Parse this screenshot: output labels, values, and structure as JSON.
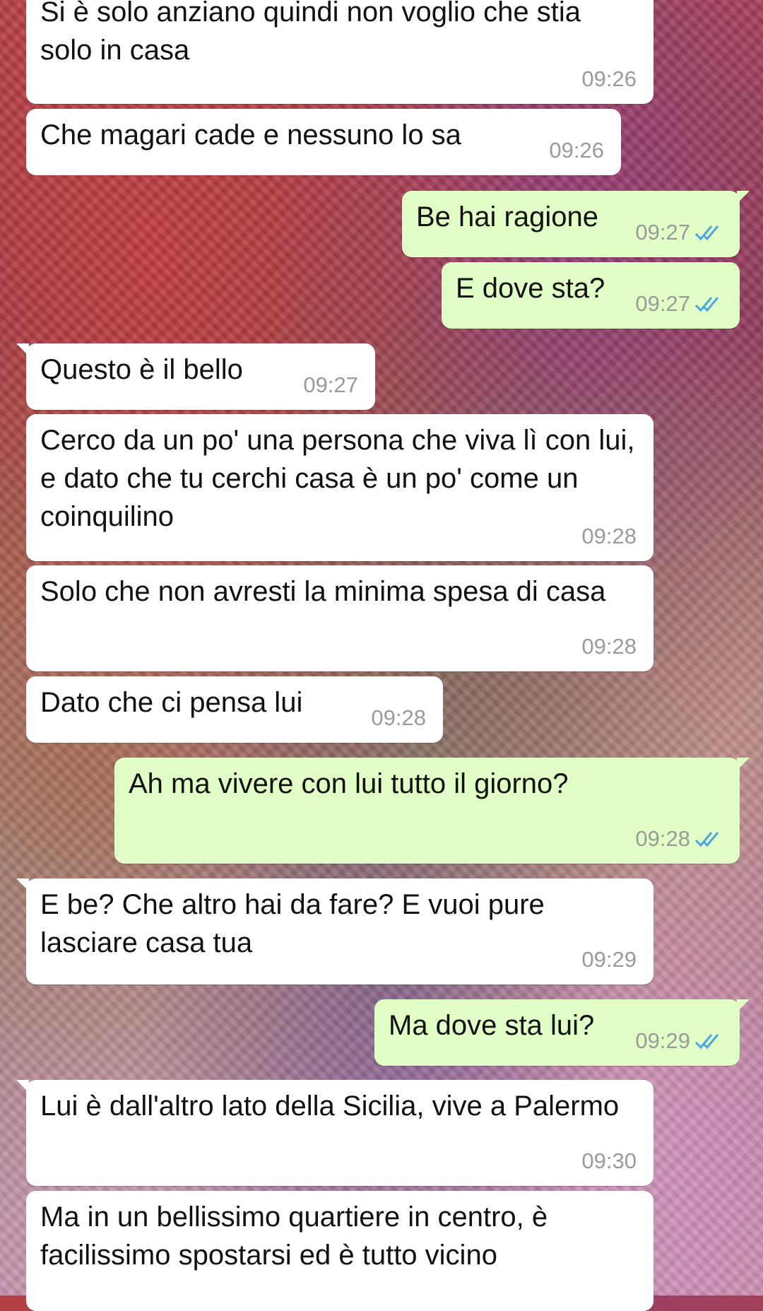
{
  "chat": {
    "messages": [
      {
        "direction": "in",
        "text": "Si è solo anziano quindi non voglio che stia solo in casa",
        "time": "09:26"
      },
      {
        "direction": "in",
        "text": "Che magari cade e nessuno lo sa",
        "time": "09:26"
      },
      {
        "direction": "out",
        "text": "Be hai ragione",
        "time": "09:27",
        "status": "read",
        "status_icon": "double-check-icon"
      },
      {
        "direction": "out",
        "text": "E dove sta?",
        "time": "09:27",
        "status": "read",
        "status_icon": "double-check-icon"
      },
      {
        "direction": "in",
        "text": "Questo è il bello",
        "time": "09:27"
      },
      {
        "direction": "in",
        "text": "Cerco da un po' una persona che viva lì con lui, e dato che tu cerchi casa è un po' come un coinquilino",
        "time": "09:28"
      },
      {
        "direction": "in",
        "text": "Solo che non avresti la minima spesa di casa",
        "time": "09:28"
      },
      {
        "direction": "in",
        "text": "Dato che ci pensa lui",
        "time": "09:28"
      },
      {
        "direction": "out",
        "text": "Ah ma vivere con lui tutto il giorno?",
        "time": "09:28",
        "status": "read",
        "status_icon": "double-check-icon"
      },
      {
        "direction": "in",
        "text": "E be? Che altro hai da fare? E vuoi pure lasciare casa tua",
        "time": "09:29"
      },
      {
        "direction": "out",
        "text": "Ma dove sta lui?",
        "time": "09:29",
        "status": "read",
        "status_icon": "double-check-icon"
      },
      {
        "direction": "in",
        "text": "Lui è dall'altro lato della Sicilia, vive a Palermo",
        "time": "09:30"
      },
      {
        "direction": "in",
        "text": "Ma in un bellissimo quartiere in centro, è facilissimo spostarsi ed è tutto vicino",
        "time": ""
      }
    ]
  },
  "colors": {
    "incoming_bubble": "#ffffff",
    "outgoing_bubble": "#e1fec7",
    "timestamp": "#9a9a9a",
    "read_ticks": "#4fa3e0"
  }
}
